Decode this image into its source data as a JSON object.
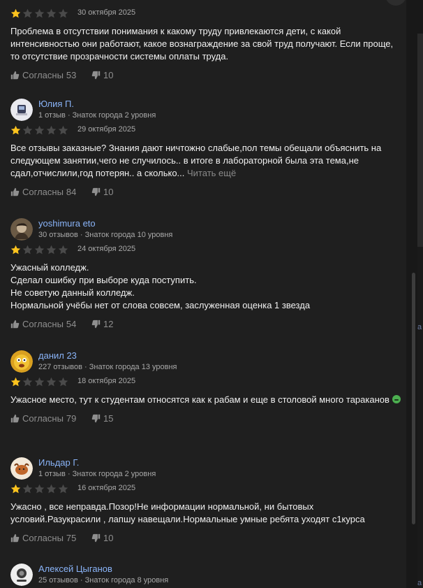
{
  "reviews": [
    {
      "author": "",
      "meta": "",
      "rating": 1,
      "date": "30 октября 2025",
      "text": "Проблема в отсутствии понимания к какому труду привлекаются дети, с какой интенсивностью они работают, какое вознаграждение за свой труд получают. Если проще, то отсутствие прозрачности системы оплаты труда.",
      "agree_label": "Согласны",
      "agree_count": "53",
      "disagree_count": "10"
    },
    {
      "author": "Юлия П.",
      "meta": "1 отзыв · Знаток города 2 уровня",
      "rating": 1,
      "date": "29 октября 2025",
      "text": "Все отзывы заказные? Знания дают ничтожно слабые,пол темы обещали объяснить на следующем занятии,чего не случилось.. в итоге в лабораторной была эта тема,не сдал,отчислили,год потерян.. а сколько...",
      "read_more": "Читать ещё",
      "agree_label": "Согласны",
      "agree_count": "84",
      "disagree_count": "10"
    },
    {
      "author": "yoshimura eto",
      "meta": "30 отзывов · Знаток города 10 уровня",
      "rating": 1,
      "date": "24 октября 2025",
      "text": "Ужасный колледж.\nСделал ошибку при выборе куда поступить.\nНе советую данный колледж.\nНормальной учёбы нет от слова совсем, заслуженная оценка 1 звезда",
      "agree_label": "Согласны",
      "agree_count": "54",
      "disagree_count": "12"
    },
    {
      "author": "данил 23",
      "meta": "227 отзывов · Знаток города 13 уровня",
      "rating": 1,
      "date": "18 октября 2025",
      "text": "Ужасное место, тут к студентам относятся как к рабам и еще в столовой много тараканов",
      "agree_label": "Согласны",
      "agree_count": "79",
      "disagree_count": "15"
    },
    {
      "author": "Ильдар Г.",
      "meta": "1 отзыв · Знаток города 2 уровня",
      "rating": 1,
      "date": "16 октября 2025",
      "text": "Ужасно , все неправда.Позор!Не информации нормальной, ни бытовых условий.Разукрасили , лапшу навещали.Нормальные умные ребята уходят с1курса",
      "agree_label": "Согласны",
      "agree_count": "75",
      "disagree_count": "10"
    },
    {
      "author": "Алексей Цыганов",
      "meta": "25 отзывов · Знаток города 8 уровня",
      "rating": 0,
      "date": "",
      "text": "",
      "agree_label": "",
      "agree_count": "",
      "disagree_count": ""
    }
  ],
  "edge_letters": [
    "а",
    "а"
  ],
  "colors": {
    "star_filled": "#fcc31e",
    "star_empty": "#4a4a4a",
    "author_link": "#8ab4f8",
    "background": "#1f1f1f"
  }
}
